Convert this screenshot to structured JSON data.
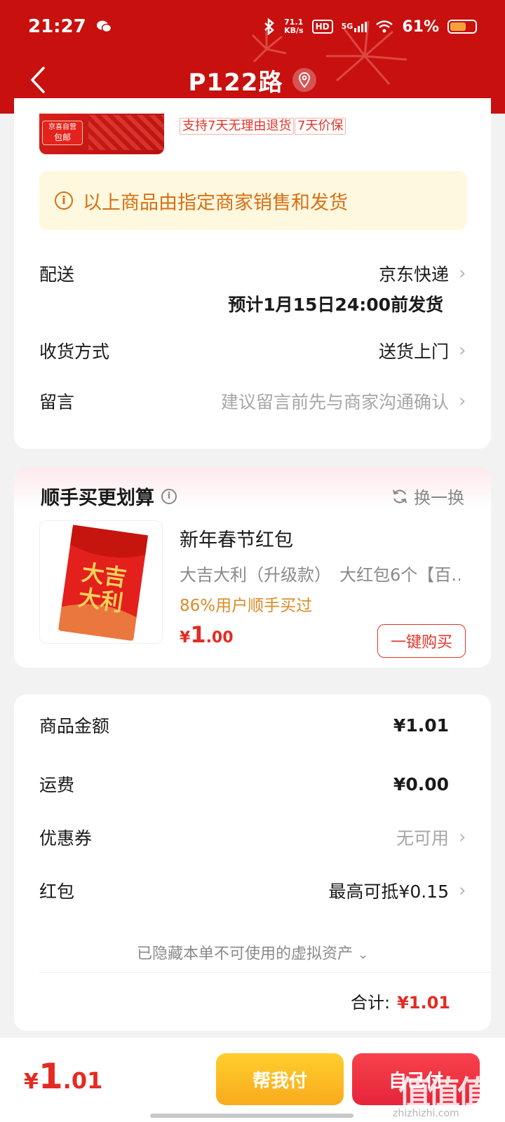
{
  "status_bar": {
    "time": "21:27",
    "speed_value": "71.1",
    "speed_unit": "KB/s",
    "hd": "HD",
    "network": "5G",
    "battery": "61%"
  },
  "header": {
    "title": "P122路"
  },
  "product": {
    "thumb_badge_line1": "京喜自营",
    "thumb_badge_line2": "包邮",
    "tags": [
      "支持7天无理由退货",
      "7天价保"
    ]
  },
  "notice": {
    "icon": "info-icon",
    "text": "以上商品由指定商家销售和发货"
  },
  "delivery": {
    "label": "配送",
    "value": "京东快递",
    "estimate": "预计1月15日24:00前发货"
  },
  "receive_method": {
    "label": "收货方式",
    "value": "送货上门"
  },
  "message": {
    "label": "留言",
    "placeholder": "建议留言前先与商家沟通确认"
  },
  "recommend": {
    "title": "顺手买更划算",
    "refresh_label": "换一换",
    "item": {
      "name": "新年春节红包",
      "desc": "大吉大利（升级款）　大红包6个【百…",
      "stat": "86%用户顺手买过",
      "price_currency": "¥",
      "price_int": "1",
      "price_dec": ".00",
      "buy_label": "一键购买",
      "image_text": "大吉大利"
    }
  },
  "summary": {
    "goods_label": "商品金额",
    "goods_value": "¥1.01",
    "shipping_label": "运费",
    "shipping_value": "¥0.00",
    "coupon_label": "优惠券",
    "coupon_value": "无可用",
    "redpacket_label": "红包",
    "redpacket_value": "最高可抵¥0.15",
    "hidden_assets": "已隐藏本单不可使用的虚拟资产",
    "total_label": "合计:",
    "total_value": "¥1.01"
  },
  "bottom": {
    "price_currency": "¥",
    "price_int": "1",
    "price_dec": ".01",
    "help_pay_label": "帮我付",
    "self_pay_label": "自己付",
    "watermark": "值值值",
    "watermark_sub": "zhizhizhi.com"
  },
  "colors": {
    "header_red": "#c8100f",
    "price_red": "#e32b22",
    "notice_orange": "#d86f16",
    "help_yellow": "#f9ab1d",
    "pay_red": "#e6243a"
  }
}
